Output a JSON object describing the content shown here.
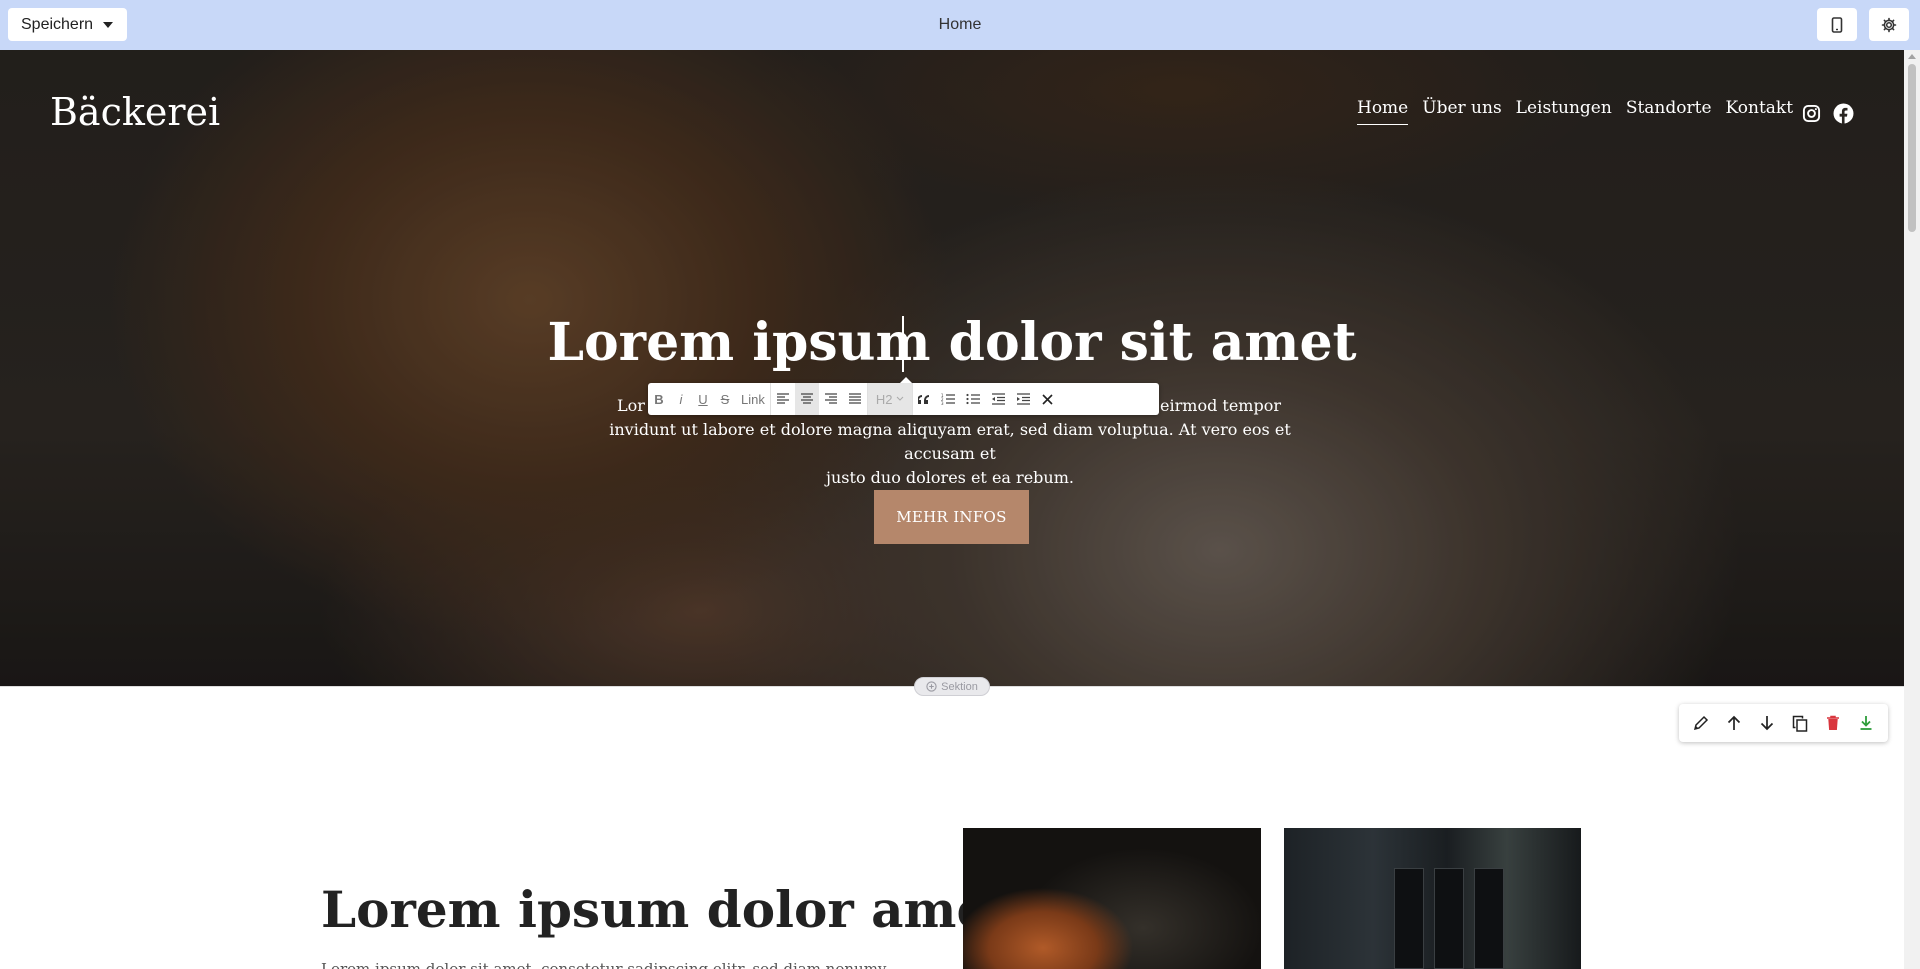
{
  "topbar": {
    "save_label": "Speichern",
    "page_name": "Home"
  },
  "hero": {
    "brand": "Bäckerei",
    "nav": [
      "Home",
      "Über uns",
      "Leistungen",
      "Standorte",
      "Kontakt"
    ],
    "active_nav": "Home",
    "title": "Lorem ipsum dolor sit amet",
    "text_line1_left": "Lor",
    "text_line1_right": "eirmod tempor",
    "text_line2": "invidunt ut labore et dolore magna aliquyam erat, sed diam voluptua. At vero eos et accusam et",
    "text_line3": "justo duo dolores et ea rebum.",
    "button": "MEHR INFOS"
  },
  "format_toolbar": {
    "bold": "B",
    "italic": "i",
    "underline": "U",
    "strike": "S",
    "link": "Link",
    "heading": "H2"
  },
  "section_add": {
    "label": "Sektion"
  },
  "section2": {
    "title": "Lorem ipsum dolor amet",
    "text": "Lorem ipsum dolor sit amet, consetetur sadipscing elitr, sed diam nonumy eirmod"
  },
  "colors": {
    "topbar_bg": "#c8d8f8",
    "accent_button": "#b5876b",
    "delete_red": "#d9363e",
    "download_green": "#2e9d3a"
  }
}
